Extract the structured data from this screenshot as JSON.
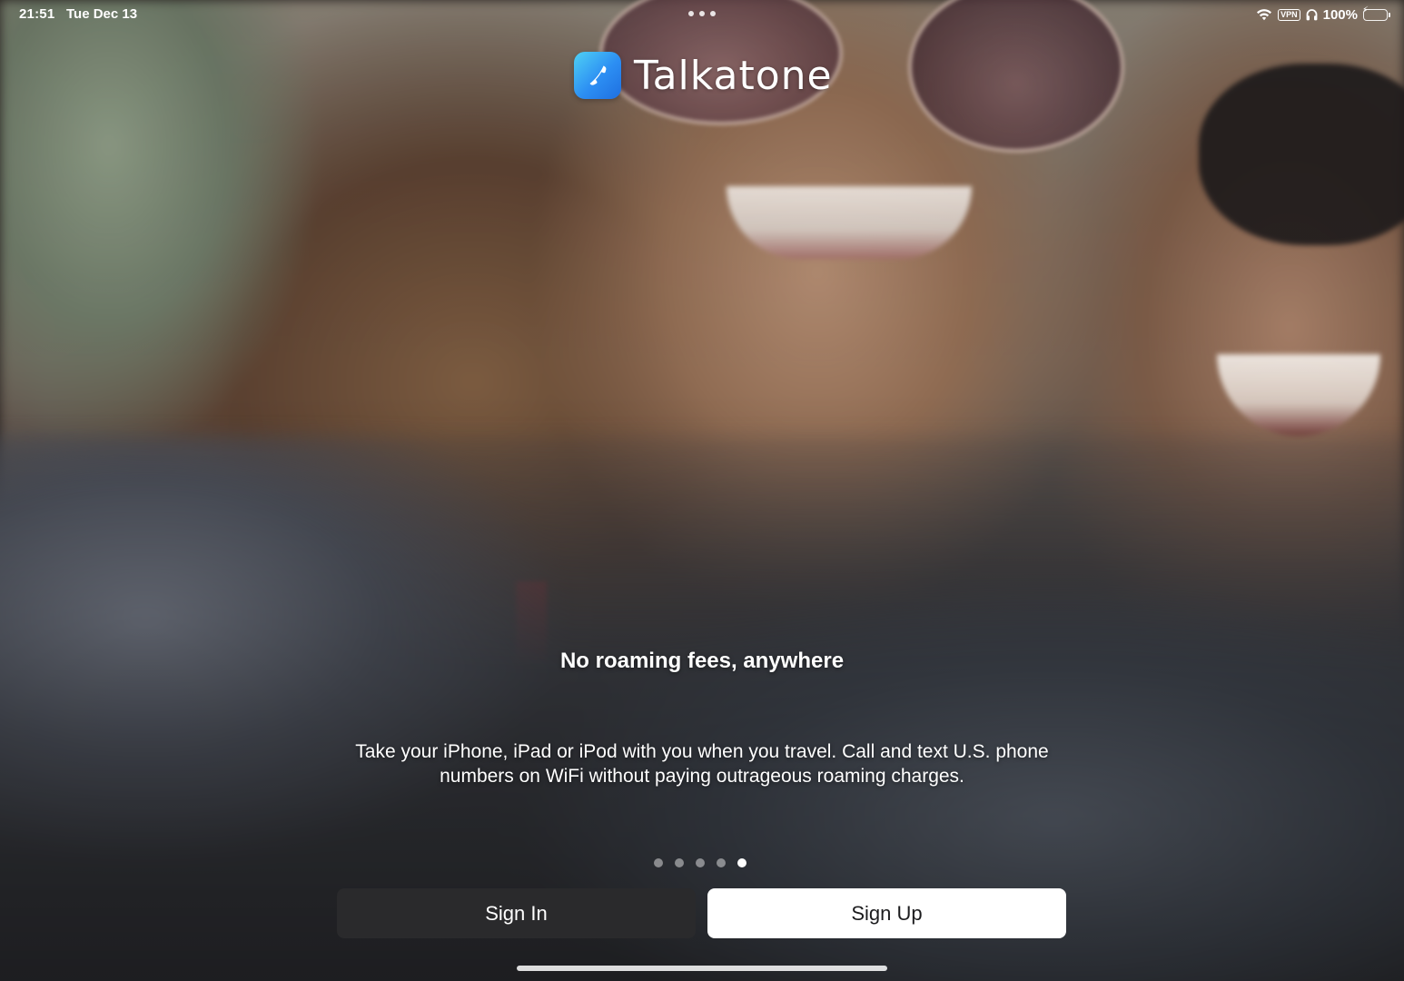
{
  "status_bar": {
    "time": "21:51",
    "date": "Tue Dec 13",
    "vpn_label": "VPN",
    "battery_percent": "100%",
    "battery_level": 1.0,
    "battery_charging": true,
    "icons": [
      "wifi-icon",
      "vpn-badge",
      "headphones-icon",
      "battery-icon"
    ]
  },
  "app": {
    "name": "Talkatone",
    "logo_icon": "phone-handset-icon",
    "logo_gradient": [
      "#4fd1f5",
      "#2c8ef3",
      "#1f6fe0"
    ]
  },
  "onboarding": {
    "headline": "No roaming fees, anywhere",
    "description": "Take your iPhone, iPad or iPod with you when you travel. Call and text U.S. phone numbers on WiFi without paying outrageous roaming charges.",
    "page_count": 5,
    "current_page": 5
  },
  "actions": {
    "sign_in_label": "Sign In",
    "sign_up_label": "Sign Up"
  },
  "colors": {
    "sign_in_bg": "#2a2a2c",
    "sign_up_bg": "#ffffff",
    "battery_green": "#35c759"
  }
}
